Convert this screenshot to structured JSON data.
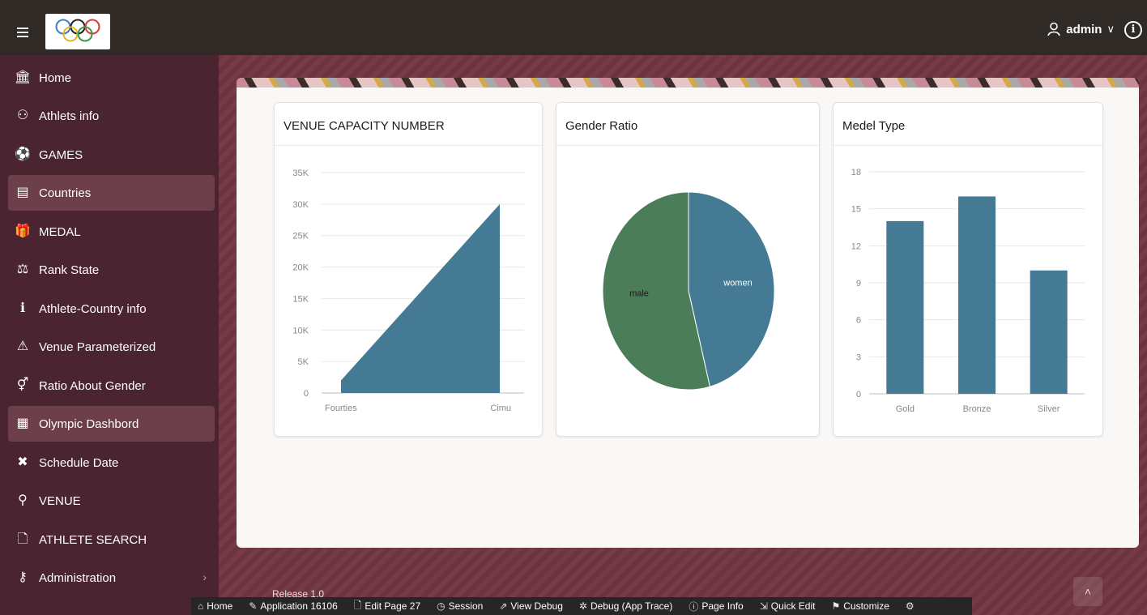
{
  "header": {
    "user": "admin",
    "user_chevron": "∨",
    "info_glyph": "i"
  },
  "icons": {
    "menu": "hamburger-menu-icon",
    "logo": "olympic-rings-logo",
    "user": "user-icon",
    "info": "info-icon"
  },
  "colors": {
    "topbar": "#302a27",
    "sidebar": "#4a2430",
    "sidebar_active": "#6d3f4b",
    "chart_blue": "#447a94",
    "chart_green": "#4a7d58"
  },
  "sidebar": {
    "items": [
      {
        "label": "Home",
        "icon": "🏛"
      },
      {
        "label": "Athlets info",
        "icon": "⚇"
      },
      {
        "label": "GAMES",
        "icon": "⚽"
      },
      {
        "label": "Countries",
        "icon": "▤"
      },
      {
        "label": "MEDAL",
        "icon": "🎁"
      },
      {
        "label": "Rank State",
        "icon": "⚖"
      },
      {
        "label": "Athlete-Country info",
        "icon": "ℹ"
      },
      {
        "label": "Venue Parameterized",
        "icon": "⚠"
      },
      {
        "label": "Ratio About Gender",
        "icon": "⚥"
      },
      {
        "label": "Olympic Dashbord",
        "icon": "▦"
      },
      {
        "label": "Schedule Date",
        "icon": "✖"
      },
      {
        "label": "VENUE",
        "icon": "⚲"
      },
      {
        "label": "ATHLETE SEARCH",
        "icon": "🗋"
      },
      {
        "label": "Administration",
        "icon": "⚷",
        "chevron": "›"
      }
    ]
  },
  "cards": {
    "venue_title": "VENUE CAPACITY NUMBER",
    "gender_title": "Gender Ratio",
    "medal_title": "Medel Type"
  },
  "chart_data": [
    {
      "type": "area",
      "title": "VENUE CAPACITY NUMBER",
      "categories": [
        "Fourties",
        "Cimu"
      ],
      "values": [
        2000,
        30000
      ],
      "y_ticks": [
        "0",
        "5K",
        "10K",
        "15K",
        "20K",
        "25K",
        "30K",
        "35K"
      ],
      "ylim": [
        0,
        35000
      ],
      "grid": true,
      "color": "#447a94"
    },
    {
      "type": "pie",
      "title": "Gender Ratio",
      "slices": [
        {
          "label": "women",
          "value": 46,
          "color": "#447a94"
        },
        {
          "label": "male",
          "value": 54,
          "color": "#4a7d58"
        }
      ]
    },
    {
      "type": "bar",
      "title": "Medel Type",
      "categories": [
        "Gold",
        "Bronze",
        "Silver"
      ],
      "values": [
        14,
        16,
        10
      ],
      "y_ticks": [
        "0",
        "3",
        "6",
        "9",
        "12",
        "15",
        "18"
      ],
      "ylim": [
        0,
        18
      ],
      "grid": true,
      "color": "#447a94"
    }
  ],
  "footer": {
    "release": "Release 1.0",
    "scroll_top": "˄"
  },
  "devbar": {
    "items": [
      {
        "label": "Home",
        "icon": "⌂"
      },
      {
        "label": "Application 16106",
        "icon": "✎"
      },
      {
        "label": "Edit Page 27",
        "icon": "🗋"
      },
      {
        "label": "Session",
        "icon": "◷"
      },
      {
        "label": "View Debug",
        "icon": "⇗"
      },
      {
        "label": "Debug (App Trace)",
        "icon": "✲"
      },
      {
        "label": "Page Info",
        "icon": "ⓘ"
      },
      {
        "label": "Quick Edit",
        "icon": "⇲"
      },
      {
        "label": "Customize",
        "icon": "⚑"
      },
      {
        "label": "",
        "icon": "⚙"
      }
    ]
  }
}
